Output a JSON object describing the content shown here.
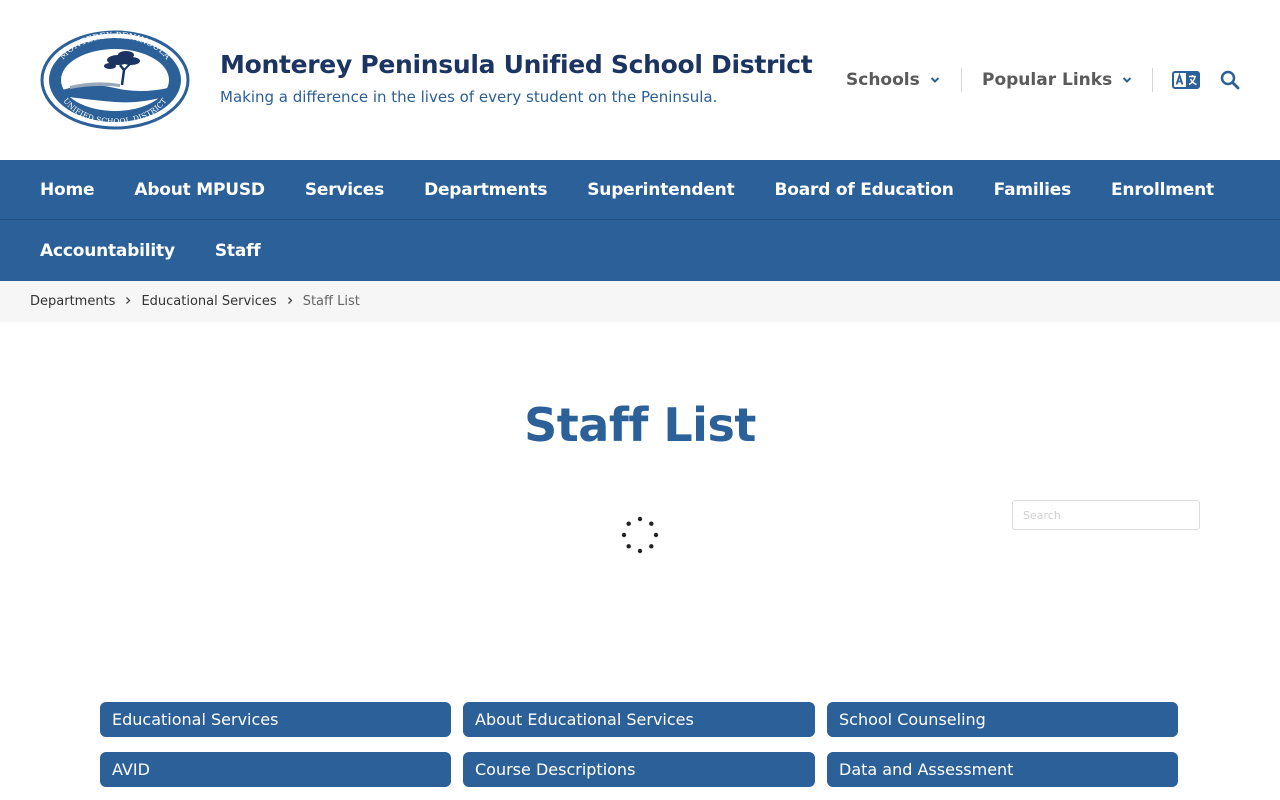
{
  "header": {
    "logo": {
      "text_top": "MONTEREY PENINSULA",
      "text_bottom": "UNIFIED SCHOOL DISTRICT"
    },
    "title": "Monterey Peninsula Unified School District",
    "tagline": "Making a difference in the lives of every student on the Peninsula.",
    "utility": {
      "schools_label": "Schools",
      "popular_links_label": "Popular Links"
    },
    "icons": [
      "translate-icon",
      "search-icon"
    ]
  },
  "nav": {
    "items": [
      "Home",
      "About MPUSD",
      "Services",
      "Departments",
      "Superintendent",
      "Board of Education",
      "Families",
      "Enrollment",
      "Accountability",
      "Staff"
    ]
  },
  "breadcrumb": {
    "items": [
      "Departments",
      "Educational Services"
    ],
    "current": "Staff List"
  },
  "main": {
    "title": "Staff List",
    "search_placeholder": "Search",
    "buttons": [
      "Educational Services",
      "About Educational Services",
      "School Counseling",
      "AVID",
      "Course Descriptions",
      "Data and Assessment"
    ]
  },
  "colors": {
    "primary": "#2b6099",
    "title_navy": "#1b3461",
    "breadcrumb_bg": "#f6f6f6"
  }
}
